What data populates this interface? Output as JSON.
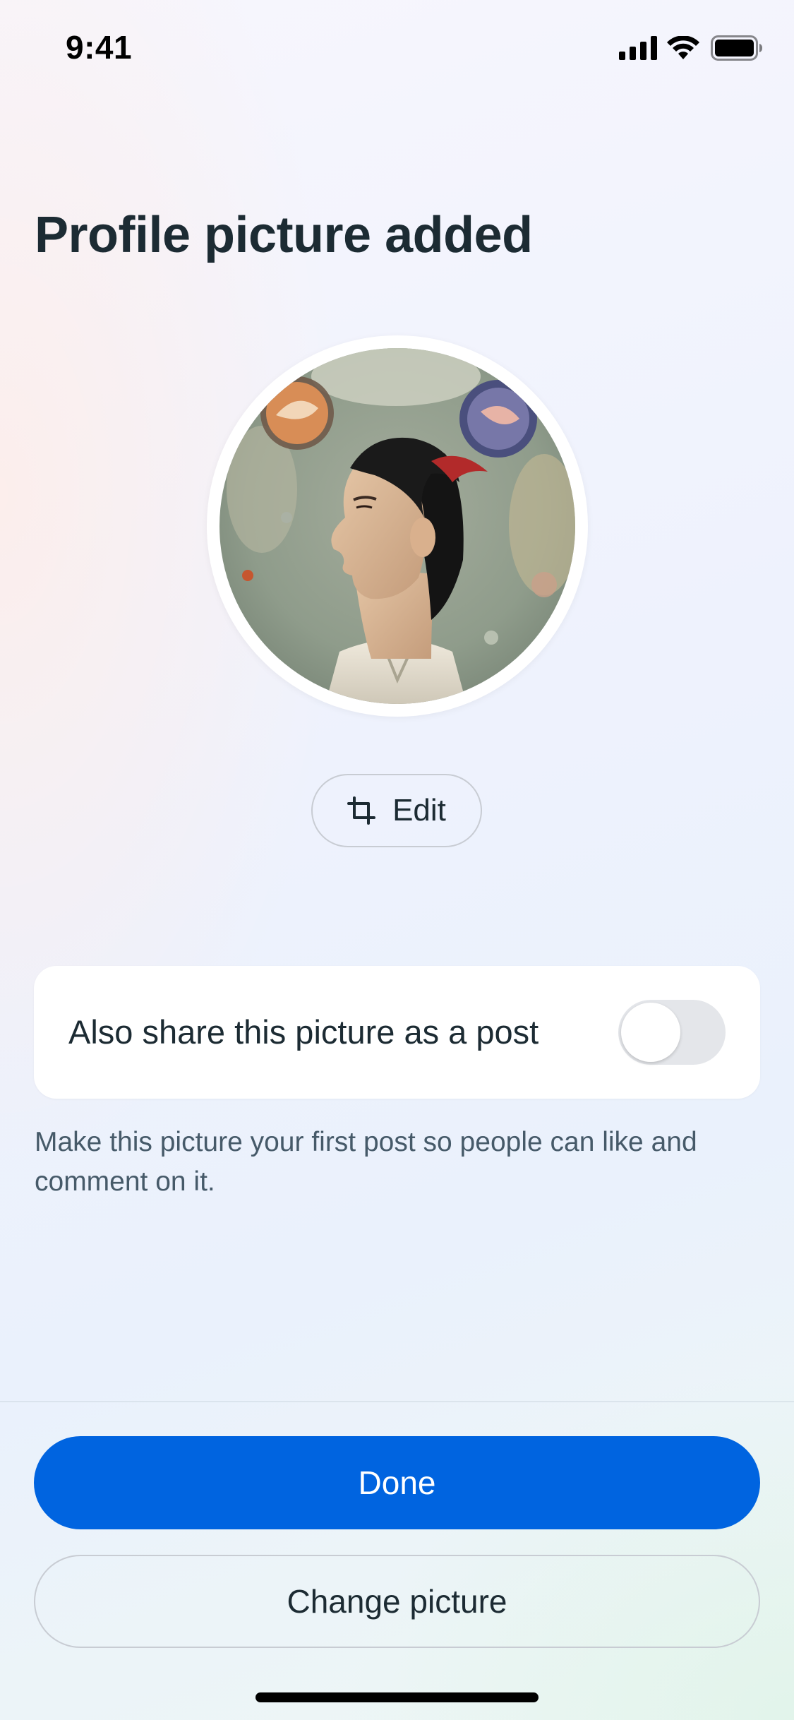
{
  "status_bar": {
    "time": "9:41",
    "icons": [
      "signal-icon",
      "wifi-icon",
      "battery-icon"
    ]
  },
  "page": {
    "title": "Profile picture added"
  },
  "avatar": {
    "description_icon": "profile-photo",
    "ring_color": "#ffffff"
  },
  "edit_button": {
    "label": "Edit",
    "icon": "crop-icon"
  },
  "share_card": {
    "label": "Also share this picture as a post",
    "toggle_on": false
  },
  "helper_text": "Make this picture your first post so people can like and comment on it.",
  "actions": {
    "done_label": "Done",
    "change_label": "Change picture"
  },
  "colors": {
    "primary": "#0064e0",
    "text": "#1c2b33",
    "secondary_text": "#465a69",
    "border": "#c8ccd3"
  }
}
